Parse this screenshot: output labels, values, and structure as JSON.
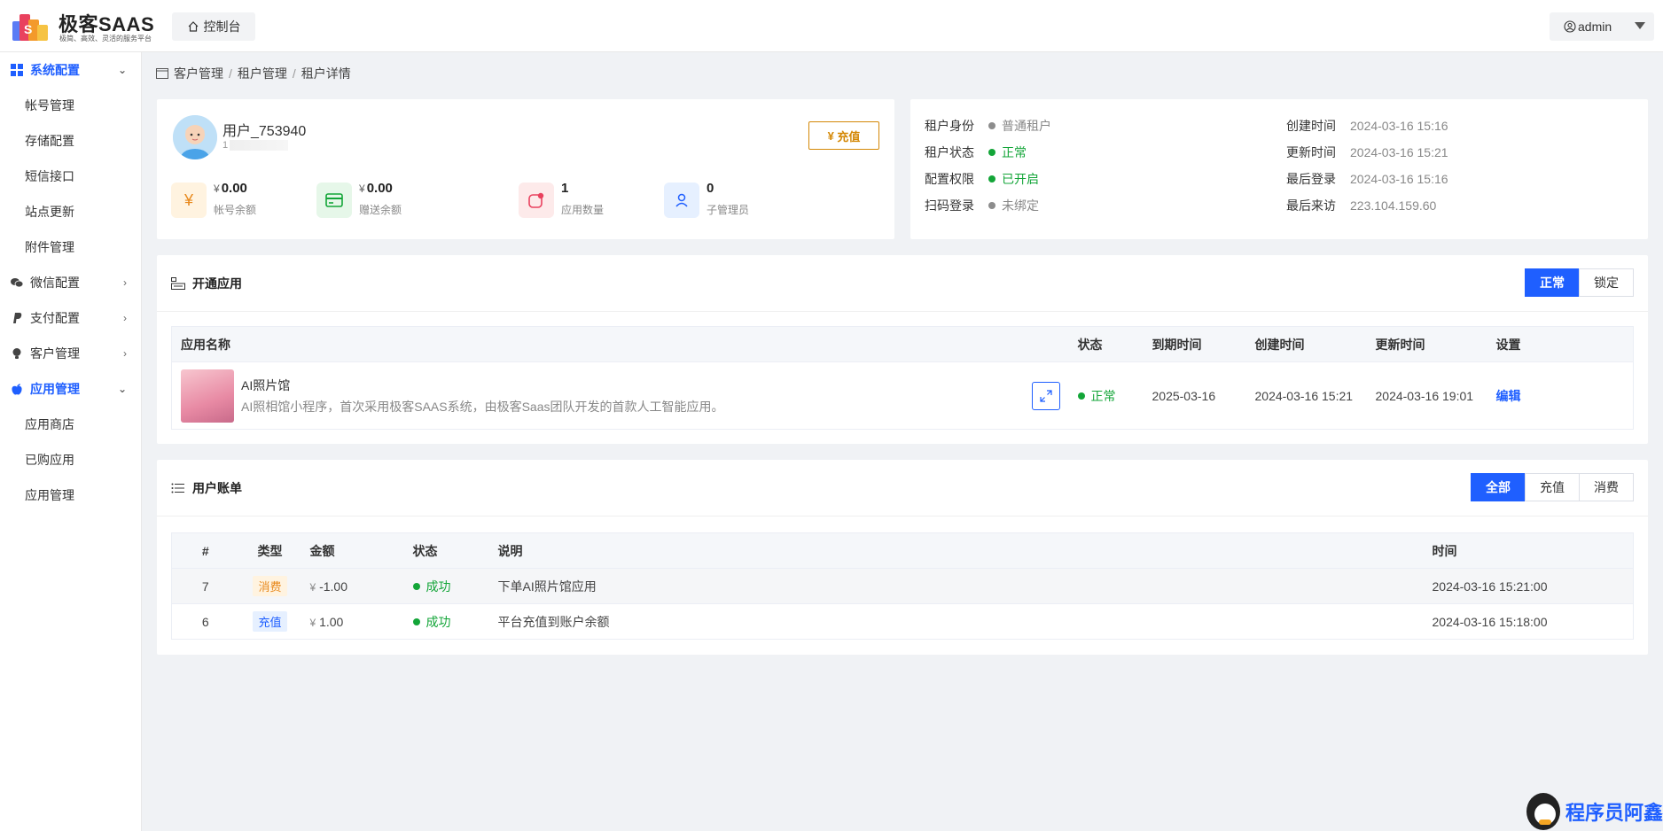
{
  "header": {
    "logo_title": "极客SAAS",
    "logo_subtitle": "极简、高效、灵活的服务平台",
    "console_label": "控制台",
    "admin_label": "admin"
  },
  "sidebar": {
    "groups": [
      {
        "label": "系统配置",
        "expanded": true,
        "items": [
          "帐号管理",
          "存储配置",
          "短信接口",
          "站点更新",
          "附件管理"
        ]
      },
      {
        "label": "微信配置",
        "expanded": false
      },
      {
        "label": "支付配置",
        "expanded": false
      },
      {
        "label": "客户管理",
        "expanded": false
      },
      {
        "label": "应用管理",
        "expanded": true,
        "items": [
          "应用商店",
          "已购应用",
          "应用管理"
        ]
      }
    ]
  },
  "breadcrumb": [
    "客户管理",
    "租户管理",
    "租户详情"
  ],
  "profile": {
    "username": "用户_753940",
    "uid_prefix": "1",
    "recharge_label": "充值",
    "currency": "¥",
    "stats": [
      {
        "value": "0.00",
        "label": "帐号余额"
      },
      {
        "value": "0.00",
        "label": "赠送余额"
      },
      {
        "value": "1",
        "label": "应用数量"
      },
      {
        "value": "0",
        "label": "子管理员"
      }
    ]
  },
  "info": {
    "left": [
      {
        "key": "租户身份",
        "value": "普通租户",
        "status": "gray"
      },
      {
        "key": "租户状态",
        "value": "正常",
        "status": "green"
      },
      {
        "key": "配置权限",
        "value": "已开启",
        "status": "green"
      },
      {
        "key": "扫码登录",
        "value": "未绑定",
        "status": "gray"
      }
    ],
    "right": [
      {
        "key": "创建时间",
        "value": "2024-03-16 15:16"
      },
      {
        "key": "更新时间",
        "value": "2024-03-16 15:21"
      },
      {
        "key": "最后登录",
        "value": "2024-03-16 15:16"
      },
      {
        "key": "最后来访",
        "value": "223.104.159.60"
      }
    ]
  },
  "apps": {
    "title": "开通应用",
    "filters": [
      "正常",
      "锁定"
    ],
    "active_filter": "正常",
    "columns": [
      "应用名称",
      "状态",
      "到期时间",
      "创建时间",
      "更新时间",
      "设置"
    ],
    "rows": [
      {
        "name": "AI照片馆",
        "desc": "AI照相馆小程序，首次采用极客SAAS系统，由极客Saas团队开发的首款人工智能应用。",
        "status": "正常",
        "expire": "2025-03-16",
        "created": "2024-03-16 15:21",
        "updated": "2024-03-16 19:01",
        "action": "编辑"
      }
    ]
  },
  "bills": {
    "title": "用户账单",
    "filters": [
      "全部",
      "充值",
      "消费"
    ],
    "active_filter": "全部",
    "columns": [
      "#",
      "类型",
      "金额",
      "状态",
      "说明",
      "时间"
    ],
    "rows": [
      {
        "id": "7",
        "type": "消费",
        "amount": "-1.00",
        "status": "成功",
        "desc": "下单AI照片馆应用",
        "time": "2024-03-16 15:21:00"
      },
      {
        "id": "6",
        "type": "充值",
        "amount": "1.00",
        "status": "成功",
        "desc": "平台充值到账户余额",
        "time": "2024-03-16 15:18:00"
      }
    ]
  },
  "watermark": "程序员阿鑫",
  "colors": {
    "accent": "#1f5fff",
    "success": "#13a538",
    "warning": "#d48806"
  }
}
